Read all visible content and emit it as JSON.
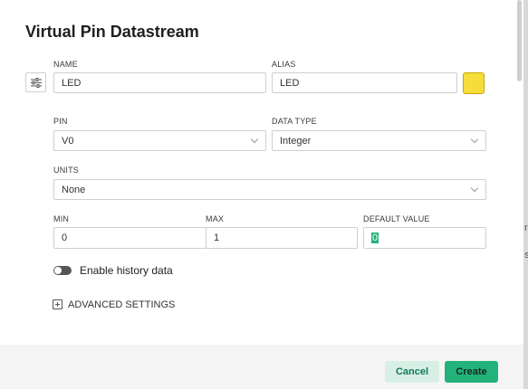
{
  "dialog": {
    "title": "Virtual Pin Datastream"
  },
  "fields": {
    "name": {
      "label": "NAME",
      "value": "LED"
    },
    "alias": {
      "label": "ALIAS",
      "value": "LED"
    },
    "color": "#f7dd3b",
    "pin": {
      "label": "PIN",
      "value": "V0"
    },
    "data_type": {
      "label": "DATA TYPE",
      "value": "Integer"
    },
    "units": {
      "label": "UNITS",
      "value": "None"
    },
    "min": {
      "label": "MIN",
      "value": "0"
    },
    "max": {
      "label": "MAX",
      "value": "1"
    },
    "default_value": {
      "label": "DEFAULT VALUE",
      "value": "0"
    }
  },
  "history": {
    "label": "Enable history data",
    "enabled": false
  },
  "advanced": {
    "label": "ADVANCED SETTINGS",
    "icon": "plus-square-icon"
  },
  "footer": {
    "cancel_label": "Cancel",
    "create_label": "Create"
  },
  "backdrop": {
    "peek_1": "r",
    "peek_2": "s"
  },
  "colors": {
    "accent": "#23b27a",
    "accent_light": "#d8efe6",
    "accent_text": "#127a55"
  }
}
